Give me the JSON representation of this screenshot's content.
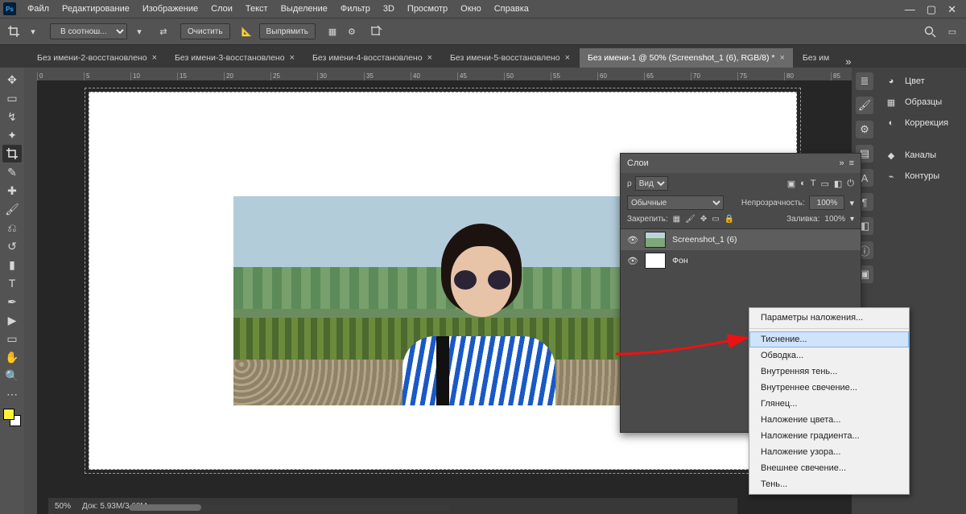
{
  "menubar": [
    "Файл",
    "Редактирование",
    "Изображение",
    "Слои",
    "Текст",
    "Выделение",
    "Фильтр",
    "3D",
    "Просмотр",
    "Окно",
    "Справка"
  ],
  "optbar": {
    "ratio_select": "В соотнош...",
    "clear": "Очистить",
    "straighten": "Выпрямить"
  },
  "tabs": [
    {
      "label": "Без имени-2-восстановлено",
      "active": false
    },
    {
      "label": "Без имени-3-восстановлено",
      "active": false
    },
    {
      "label": "Без имени-4-восстановлено",
      "active": false
    },
    {
      "label": "Без имени-5-восстановлено",
      "active": false
    },
    {
      "label": "Без имени-1 @ 50% (Screenshot_1 (6), RGB/8) *",
      "active": true
    },
    {
      "label": "Без им",
      "active": false
    }
  ],
  "ruler_marks": [
    "0",
    "5",
    "10",
    "15",
    "20",
    "25",
    "30",
    "35",
    "40",
    "45",
    "50",
    "55",
    "60",
    "65",
    "70",
    "75",
    "80",
    "85"
  ],
  "right_panels": [
    {
      "icon": "color-wheel-icon",
      "label": "Цвет"
    },
    {
      "icon": "swatches-icon",
      "label": "Образцы"
    },
    {
      "icon": "adjust-icon",
      "label": "Коррекция"
    },
    {
      "icon": "channels-icon",
      "label": "Каналы"
    },
    {
      "icon": "paths-icon",
      "label": "Контуры"
    }
  ],
  "layers_panel": {
    "title": "Слои",
    "filter_label": "Вид",
    "mode": "Обычные",
    "opacity_label": "Непрозрачность:",
    "opacity_value": "100%",
    "lock_label": "Закрепить:",
    "fill_label": "Заливка:",
    "fill_value": "100%",
    "layers": [
      {
        "name": "Screenshot_1 (6)",
        "selected": true
      },
      {
        "name": "Фон",
        "selected": false,
        "bg": true
      }
    ]
  },
  "context_menu": {
    "items_top": [
      "Параметры наложения..."
    ],
    "items_body": [
      "Тиснение...",
      "Обводка...",
      "Внутренняя тень...",
      "Внутреннее свечение...",
      "Глянец...",
      "Наложение цвета...",
      "Наложение градиента...",
      "Наложение узора...",
      "Внешнее свечение...",
      "Тень..."
    ],
    "hover_index": 0
  },
  "status": {
    "zoom": "50%",
    "docsize": "Док: 5.93M/3.62M"
  }
}
